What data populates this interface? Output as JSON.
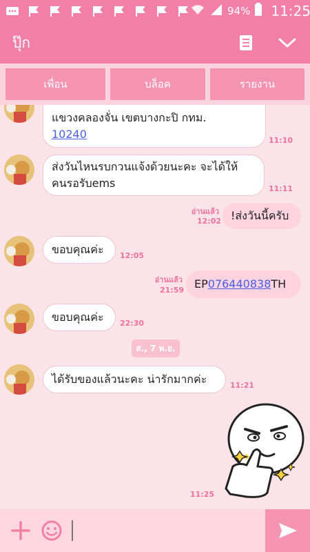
{
  "status_bar": {
    "battery": "94%",
    "time": "11:25"
  },
  "header": {
    "title": "ปุ๊ก"
  },
  "actions": {
    "friend": "เพื่อน",
    "block": "บล็อค",
    "report": "รายงาน"
  },
  "messages": {
    "m1": {
      "line1": "แขวงคลองจั่น เขตบางกะปิ กทม.",
      "link": "10240",
      "time": "11:10"
    },
    "m2": {
      "line1": "ส่งวันไหนรบกวนแจ้งด้วยนะคะ จะได้ให้",
      "line2": "คนรอรับems",
      "time": "11:11"
    },
    "m3": {
      "text": "!ส่งวันนี้ครับ",
      "read": "อ่านแล้ว",
      "time": "12:02"
    },
    "m4": {
      "text": "ขอบคุณค่ะ",
      "time": "12:05"
    },
    "m5": {
      "prefix": "EP",
      "link": "076440838",
      "suffix": "TH",
      "read": "อ่านแล้ว",
      "time": "21:59"
    },
    "m6": {
      "text": "ขอบคุณค่ะ",
      "time": "22:30"
    },
    "date": "ส., 7 พ.ย.",
    "m7": {
      "text": "ได้รับของแล้วนะคะ น่ารักมากค่ะ",
      "time": "11:21"
    },
    "m8": {
      "time": "11:25"
    }
  },
  "input": {
    "placeholder": ""
  }
}
